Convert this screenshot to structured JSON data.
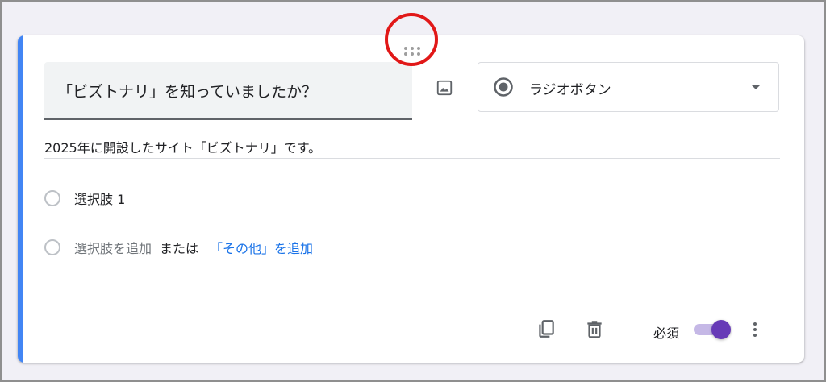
{
  "question": {
    "title": "「ビズトナリ」を知っていましたか？",
    "type_label": "ラジオボタン",
    "description": "2025年に開設したサイト「ビズトナリ」です。"
  },
  "options": [
    {
      "label": "選択肢 1"
    }
  ],
  "add_option": {
    "placeholder": "選択肢を追加",
    "or_text": "または",
    "add_other_label": "「その他」を追加"
  },
  "footer": {
    "required_label": "必須",
    "required_on": true
  },
  "icons": {
    "drag": "drag-handle-icon",
    "image": "image-icon",
    "type": "radio-button-icon",
    "dropdown": "dropdown-arrow-icon",
    "copy": "copy-icon",
    "delete": "trash-icon",
    "more": "more-vert-icon"
  },
  "colors": {
    "accent": "#4285f4",
    "theme": "#673ab7",
    "link": "#1a73e8",
    "annotation": "#e11818"
  }
}
